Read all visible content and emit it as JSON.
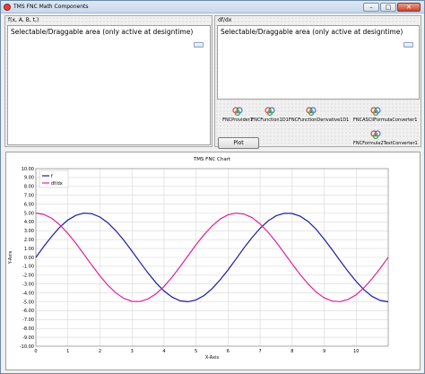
{
  "window": {
    "title": "TMS FNC Math Components"
  },
  "left_panel": {
    "field_label": "f(x, A, B, t,)",
    "area_text": "Selectable/Draggable area (only active at designtime)"
  },
  "right_panel": {
    "field_label": "df/dx",
    "area_text": "Selectable/Draggable area (only active at designtime)"
  },
  "components": [
    {
      "label": "FNCProvider1"
    },
    {
      "label": "FNCFunction1D1"
    },
    {
      "label": "FNCFunctionDerivative1D1"
    },
    {
      "label": "FNCASCIIFormulaConverter1"
    },
    {
      "label": "FNCFormula2TextConverter1"
    }
  ],
  "plot_button": {
    "label": "Plot"
  },
  "chart_data": {
    "type": "line",
    "title": "TMS FNC Chart",
    "xlabel": "X-Axis",
    "ylabel": "Y-Axis",
    "xlim": [
      0,
      11
    ],
    "ylim": [
      -10,
      10
    ],
    "x_ticks": [
      "0",
      "1",
      "2",
      "3",
      "4",
      "5",
      "6",
      "7",
      "8",
      "9",
      "10"
    ],
    "y_ticks": [
      "10.00",
      "9.00",
      "8.00",
      "7.00",
      "6.00",
      "5.00",
      "4.00",
      "3.00",
      "2.00",
      "1.00",
      "0.00",
      "-1.00",
      "-2.00",
      "-3.00",
      "-4.00",
      "-5.00",
      "-6.00",
      "-7.00",
      "-8.00",
      "-9.00",
      "-10.00"
    ],
    "grid": true,
    "legend_position": "top-left",
    "series": [
      {
        "name": "f",
        "color": "#1a1aa6",
        "x": [
          0,
          0.25,
          0.5,
          0.75,
          1,
          1.25,
          1.5,
          1.75,
          2,
          2.25,
          2.5,
          2.75,
          3,
          3.25,
          3.5,
          3.75,
          4,
          4.25,
          4.5,
          4.75,
          5,
          5.25,
          5.5,
          5.75,
          6,
          6.25,
          6.5,
          6.75,
          7,
          7.25,
          7.5,
          7.75,
          8,
          8.25,
          8.5,
          8.75,
          9,
          9.25,
          9.5,
          9.75,
          10,
          10.25,
          10.5,
          10.75,
          11
        ],
        "y": [
          0,
          1.24,
          2.4,
          3.41,
          4.21,
          4.74,
          4.99,
          4.92,
          4.55,
          3.89,
          2.99,
          1.91,
          0.71,
          -0.54,
          -1.75,
          -2.86,
          -3.78,
          -4.46,
          -4.89,
          -4.99,
          -4.79,
          -4.29,
          -3.53,
          -2.54,
          -1.4,
          -0.17,
          1.08,
          2.25,
          3.28,
          4.11,
          4.69,
          4.97,
          4.95,
          4.64,
          4.04,
          3.17,
          2.06,
          0.86,
          -0.38,
          -1.6,
          -2.72,
          -3.67,
          -4.4,
          -4.85,
          -5.0
        ]
      },
      {
        "name": "df/dx",
        "color": "#e0219a",
        "x": [
          0,
          0.25,
          0.5,
          0.75,
          1,
          1.25,
          1.5,
          1.75,
          2,
          2.25,
          2.5,
          2.75,
          3,
          3.25,
          3.5,
          3.75,
          4,
          4.25,
          4.5,
          4.75,
          5,
          5.25,
          5.5,
          5.75,
          6,
          6.25,
          6.5,
          6.75,
          7,
          7.25,
          7.5,
          7.75,
          8,
          8.25,
          8.5,
          8.75,
          9,
          9.25,
          9.5,
          9.75,
          10,
          10.25,
          10.5,
          10.75,
          11
        ],
        "y": [
          5.0,
          4.84,
          4.39,
          3.66,
          2.7,
          1.58,
          0.35,
          -0.89,
          -2.08,
          -3.14,
          -4.01,
          -4.62,
          -4.95,
          -4.97,
          -4.68,
          -4.1,
          -3.27,
          -2.23,
          -1.05,
          0.19,
          1.42,
          2.56,
          3.54,
          4.31,
          4.8,
          4.99,
          4.88,
          4.47,
          3.77,
          2.83,
          1.73,
          0.5,
          -0.73,
          -1.93,
          -3.0,
          -3.9,
          -4.56,
          -4.92,
          -4.98,
          -4.73,
          -4.2,
          -3.39,
          -2.38,
          -1.22,
          0.02
        ]
      }
    ]
  }
}
